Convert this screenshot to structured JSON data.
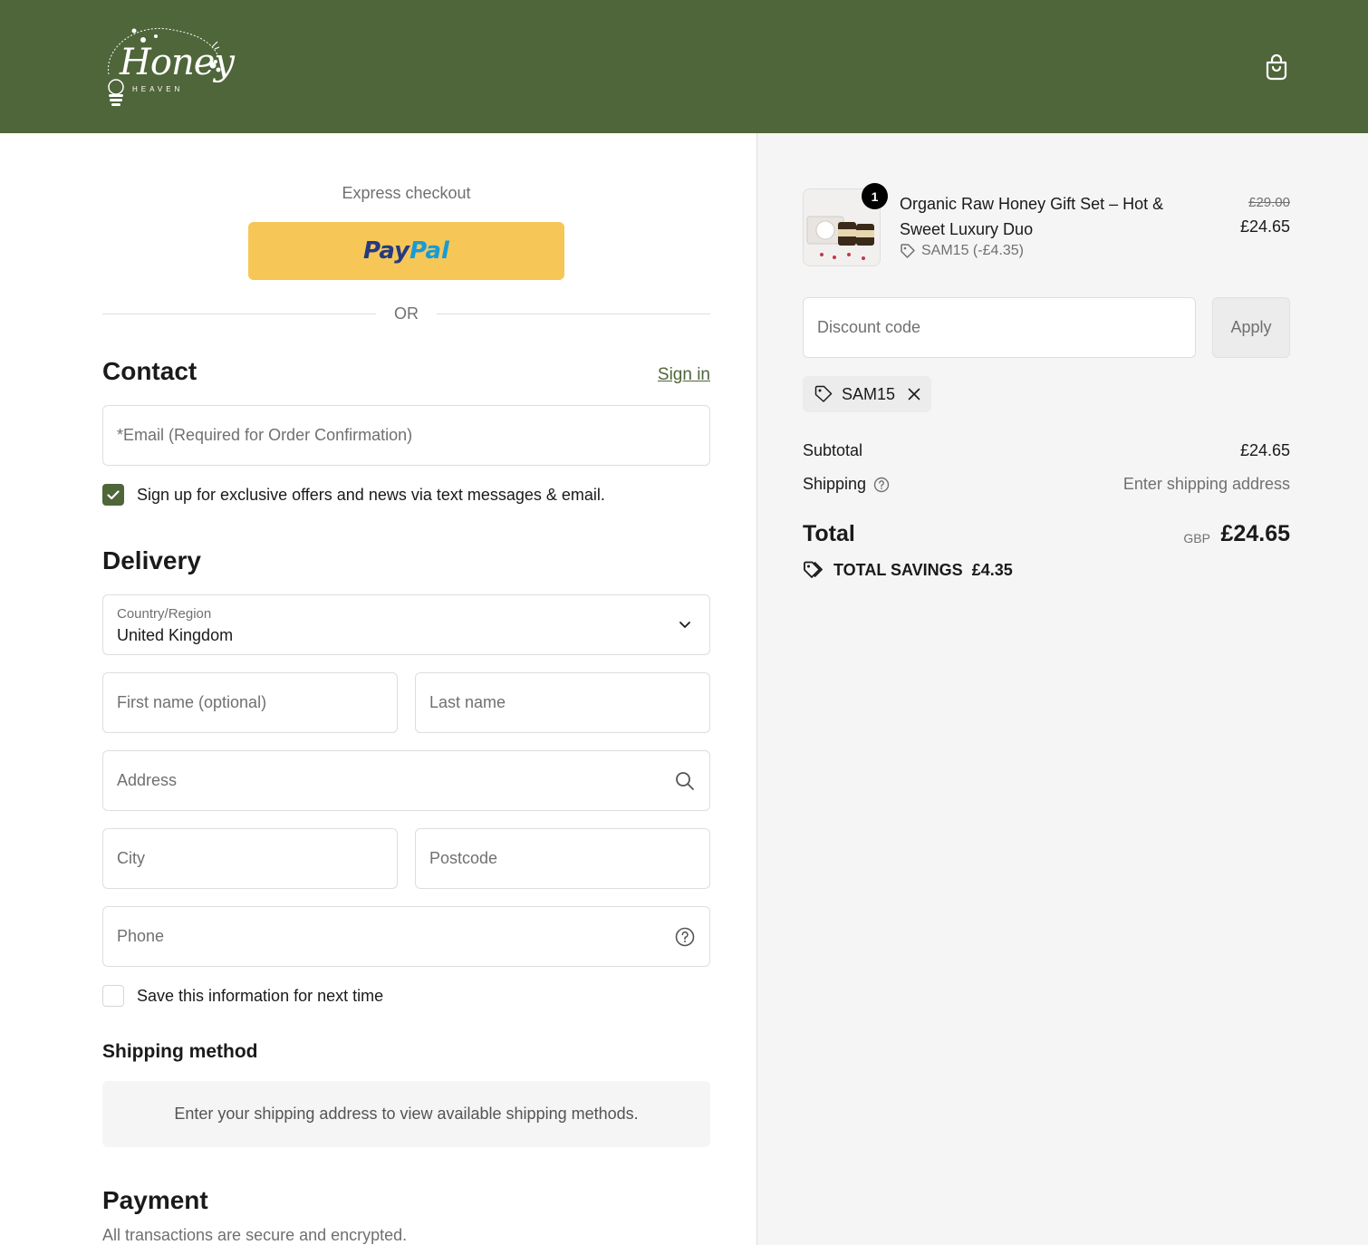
{
  "header": {
    "logo_text": "Honey",
    "logo_subtext": "HEAVEN",
    "bg_color": "#4f653a"
  },
  "express": {
    "label": "Express checkout",
    "paypal_part1": "Pay",
    "paypal_part2": "Pal",
    "or": "OR"
  },
  "contact": {
    "title": "Contact",
    "sign_in": "Sign in",
    "email_placeholder": "*Email (Required for Order Confirmation)",
    "offers_label": "Sign up for exclusive offers and news via text messages & email.",
    "offers_checked": true
  },
  "delivery": {
    "title": "Delivery",
    "country_label": "Country/Region",
    "country_value": "United Kingdom",
    "first_name_placeholder": "First name (optional)",
    "last_name_placeholder": "Last name",
    "address_placeholder": "Address",
    "city_placeholder": "City",
    "postcode_placeholder": "Postcode",
    "phone_placeholder": "Phone",
    "save_info_label": "Save this information for next time",
    "save_info_checked": false
  },
  "shipping_method": {
    "title": "Shipping method",
    "message": "Enter your shipping address to view available shipping methods."
  },
  "payment": {
    "title": "Payment",
    "subtitle": "All transactions are secure and encrypted."
  },
  "order": {
    "quantity": "1",
    "product_name": "Organic Raw Honey Gift Set – Hot & Sweet Luxury Duo",
    "product_discount": "SAM15 (-£4.35)",
    "price_original": "£29.00",
    "price_current": "£24.65",
    "discount_placeholder": "Discount code",
    "apply_label": "Apply",
    "applied_code": "SAM15",
    "subtotal_label": "Subtotal",
    "subtotal_value": "£24.65",
    "shipping_label": "Shipping",
    "shipping_value": "Enter shipping address",
    "total_label": "Total",
    "currency": "GBP",
    "total_value": "£24.65",
    "savings_label": "TOTAL SAVINGS",
    "savings_value": "£4.35"
  }
}
